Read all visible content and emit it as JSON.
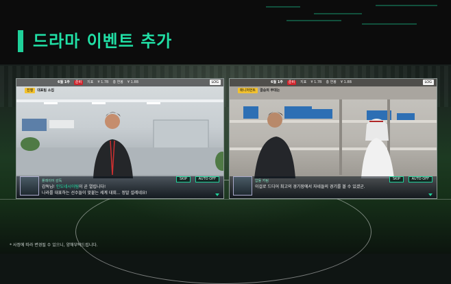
{
  "page": {
    "title": "드라마 이벤트 추가",
    "footnote": "* 사정에 따라 변경될 수 있으니, 양해부탁드립니다.",
    "accent_color": "#1fd19a"
  },
  "screens": [
    {
      "hud": {
        "date": "6월 1주",
        "pill": "준비",
        "stat1": "지표",
        "stat2": "¥ 1.7B",
        "stat3": "총 연봉",
        "stat4": "¥ 1.8B",
        "log_label": "LOG"
      },
      "tag": {
        "chip": "진행",
        "text": "대표팀 소집"
      },
      "dialog": {
        "speaker": "플레이어 감독",
        "line1_pre": "감독님! ",
        "line1_hl": "인도네시아팀",
        "line1_post": "이 곧 열립니다!",
        "line2": "나라를 대표하는 선수들이 맞붙는 세계 대회... 정말 설레네요!",
        "skip": "SKIP",
        "auto": "AUTO OFF"
      }
    },
    {
      "hud": {
        "date": "6월 1주",
        "pill": "준비",
        "stat1": "지표",
        "stat2": "¥ 1.7B",
        "stat3": "총 연봉",
        "stat4": "¥ 1.8B",
        "log_label": "LOG"
      },
      "tag": {
        "chip": "매니저먼트",
        "text": "결승의 무대는"
      },
      "dialog": {
        "speaker": "압둘 카림",
        "line1": "이걸로 드디어 최고의 경기장에서 자네들의 경기를 볼 수 있겠군.",
        "skip": "SKIP",
        "auto": "AUTO OFF"
      }
    }
  ]
}
